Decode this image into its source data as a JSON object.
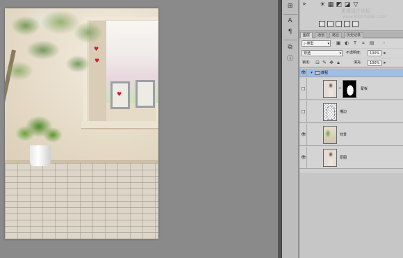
{
  "panel_tabs": [
    {
      "label": "图层",
      "active": true
    },
    {
      "label": "通道",
      "active": false
    },
    {
      "label": "路径",
      "active": false
    },
    {
      "label": "历史记录",
      "active": false
    }
  ],
  "filter": {
    "kind": "类型",
    "icons": [
      "image-filter-icon",
      "adjustment-filter-icon",
      "type-filter-icon",
      "shape-filter-icon",
      "smart-object-filter-icon"
    ]
  },
  "blend_mode": "穿透",
  "opacity": {
    "label": "不透明度:",
    "value": "100%"
  },
  "lock": {
    "label": "锁定:"
  },
  "fill": {
    "label": "填充:",
    "value": "100%"
  },
  "group": {
    "name": "教程",
    "expanded": true,
    "visible": true
  },
  "layers": [
    {
      "name": "蒙板",
      "visible": false,
      "has_mask": true
    },
    {
      "name": "描边",
      "visible": false,
      "has_mask": false
    },
    {
      "name": "背景",
      "visible": true,
      "has_mask": false
    },
    {
      "name": "原图",
      "visible": true,
      "has_mask": false
    }
  ],
  "watermark": {
    "cn": "思缘设计论坛",
    "en": "www.MISSYUAN.COM"
  },
  "icon_column": [
    "arrange-icon",
    "character-icon",
    "paragraph-icon",
    "navigator-icon",
    "info-icon"
  ],
  "colors": {
    "panel_bg": "#c9c9c9",
    "canvas_bg": "#8a8a8a",
    "selected_row": "#9fbde6"
  }
}
